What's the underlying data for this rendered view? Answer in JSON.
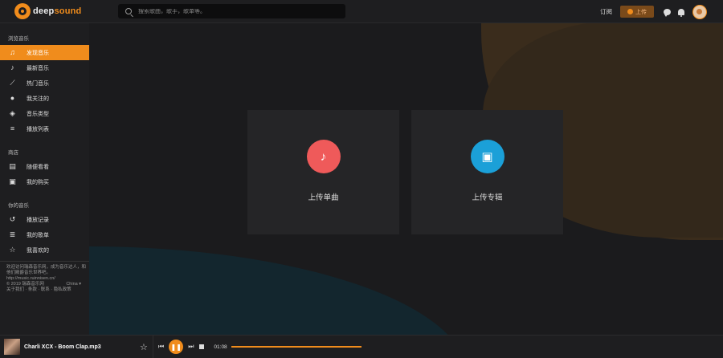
{
  "brand": {
    "part1": "deep",
    "part2": "sound"
  },
  "search": {
    "placeholder": "搜索歌曲，歌手，歌单等。"
  },
  "header": {
    "subscribe": "订阅",
    "upload": "上传"
  },
  "sidebar": {
    "sections": [
      {
        "title": "浏览音乐",
        "items": [
          {
            "label": "发现音乐",
            "icon": "music-note-icon",
            "glyph": "♫",
            "active": true
          },
          {
            "label": "最新音乐",
            "icon": "single-note-icon",
            "glyph": "♪",
            "active": false
          },
          {
            "label": "热门音乐",
            "icon": "trending-chart-icon",
            "glyph": "⟋",
            "active": false
          },
          {
            "label": "我关注的",
            "icon": "drop-icon",
            "glyph": "●",
            "active": false
          },
          {
            "label": "音乐类型",
            "icon": "layers-icon",
            "glyph": "◈",
            "active": false
          },
          {
            "label": "播放列表",
            "icon": "playlist-icon",
            "glyph": "≡",
            "active": false
          }
        ]
      },
      {
        "title": "商店",
        "items": [
          {
            "label": "随便看看",
            "icon": "store-icon",
            "glyph": "▤",
            "active": false
          },
          {
            "label": "我的购买",
            "icon": "bag-icon",
            "glyph": "▣",
            "active": false
          }
        ]
      },
      {
        "title": "你的音乐",
        "items": [
          {
            "label": "播放记录",
            "icon": "history-icon",
            "glyph": "↺",
            "active": false
          },
          {
            "label": "我的歌单",
            "icon": "queue-icon",
            "glyph": "≣",
            "active": false
          },
          {
            "label": "我喜欢的",
            "icon": "star-outline-icon",
            "glyph": "☆",
            "active": false
          }
        ]
      }
    ],
    "footer": {
      "intro": "欢迎访问瑞森音乐网，成为音乐达人，和他们殿爵音乐世界吧。",
      "url": "http://music.ruinnisen.cn/",
      "copyright": "© 2019 瑞森音乐网",
      "region": "China ▾",
      "links": "关于我们 · 条款 · 联系 · 隐私政策"
    }
  },
  "cards": [
    {
      "label": "上传单曲",
      "color": "#ef5a5a",
      "icon": "music-note-icon",
      "glyph": "♪"
    },
    {
      "label": "上传专辑",
      "color": "#1ba0d8",
      "icon": "album-icon",
      "glyph": "▣"
    }
  ],
  "player": {
    "track": "Charli XCX - Boom Clap.mp3",
    "time": "01:08"
  }
}
